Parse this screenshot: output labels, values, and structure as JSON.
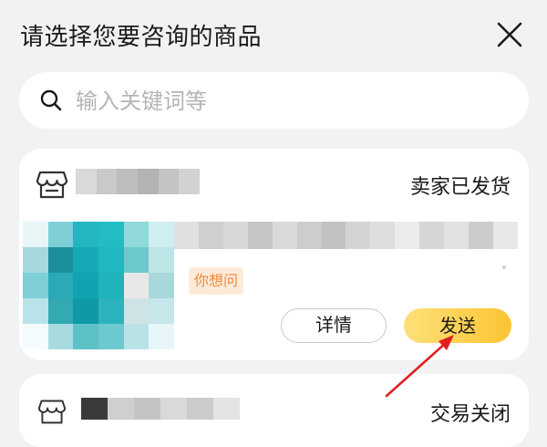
{
  "dialog": {
    "title": "请选择您要咨询的商品",
    "close_icon": "close-icon"
  },
  "search": {
    "placeholder": "输入关键词等",
    "value": "",
    "icon": "search-icon"
  },
  "orders": [
    {
      "shop_icon": "shop-icon",
      "shop_name": "",
      "status": "卖家已发货",
      "product_title": "",
      "tag": "你想问",
      "detail_label": "详情",
      "send_label": "发送"
    },
    {
      "shop_icon": "shop-icon",
      "shop_name": "",
      "status": "交易关闭"
    }
  ],
  "colors": {
    "background": "#f2f2f4",
    "card": "#ffffff",
    "send_button": "#fbc532",
    "tag_text": "#f08a3a",
    "tag_bg": "#fdebd9",
    "annotation_arrow": "#e02020"
  },
  "annotation": {
    "type": "arrow",
    "points_to": "send-button"
  }
}
